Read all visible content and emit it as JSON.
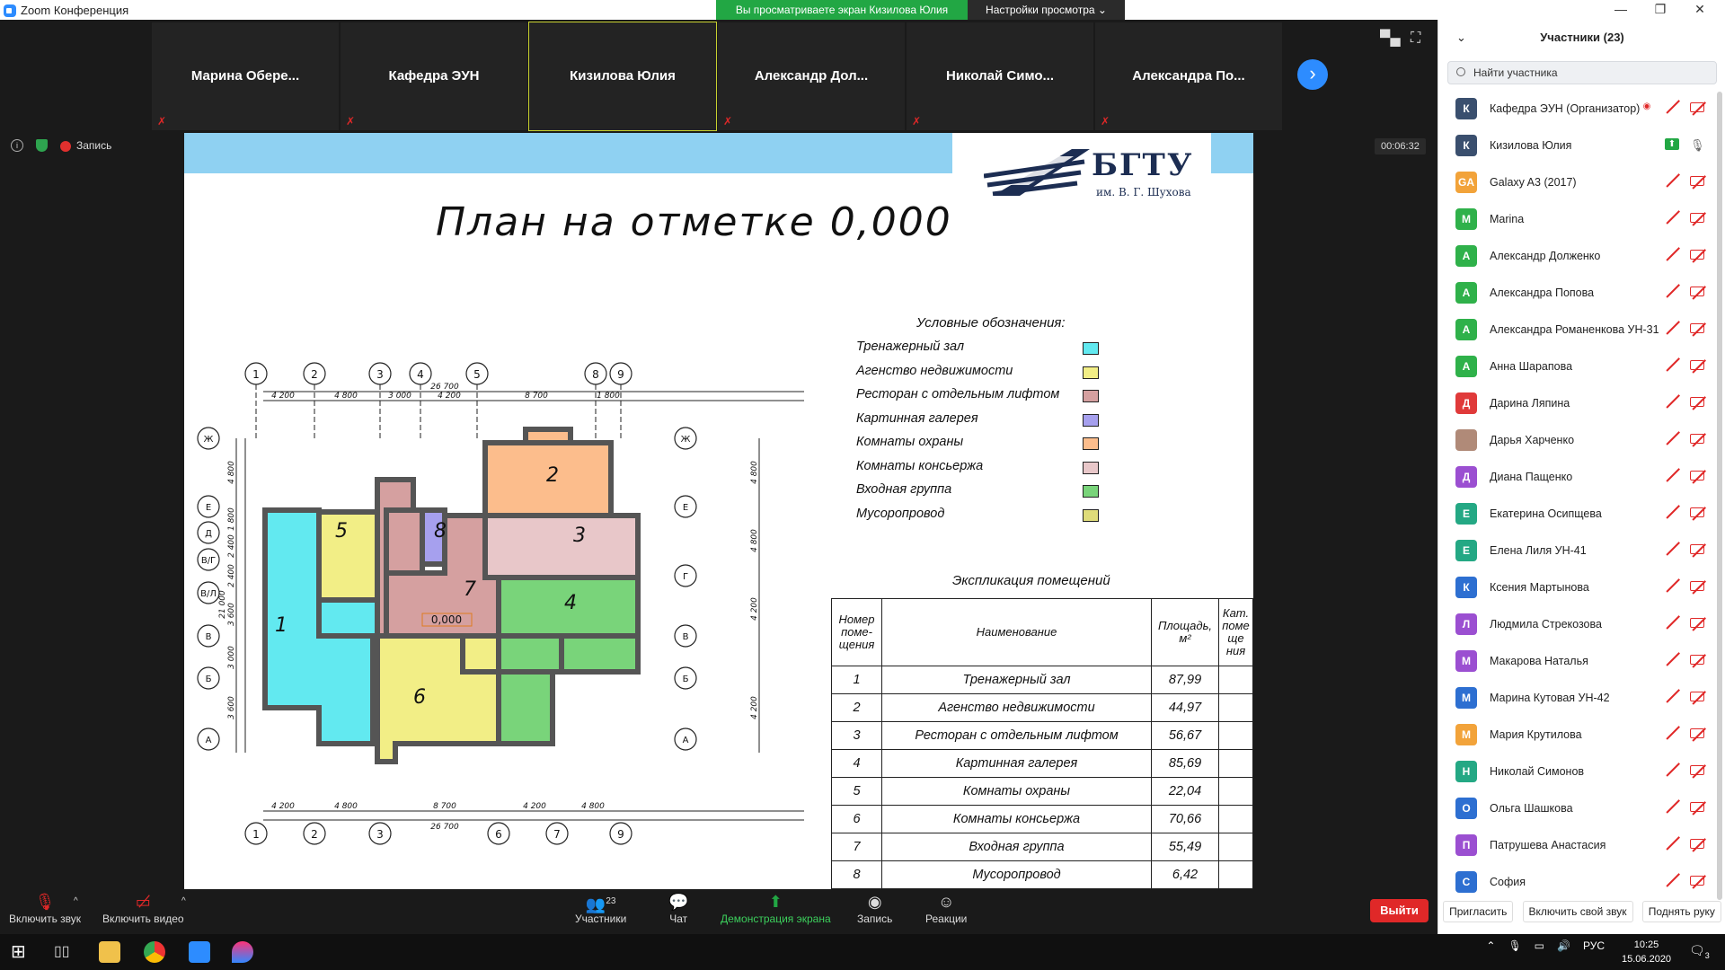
{
  "window": {
    "title": "Zoom Конференция",
    "minimize_label": "—",
    "maximize_label": "❐",
    "close_label": "✕"
  },
  "share_banner": {
    "viewing_label": "Вы просматриваете экран Кизилова Юлия",
    "settings_label": "Настройки просмотра ⌄"
  },
  "tiles": [
    {
      "name": "Марина  Обере...",
      "muted": true
    },
    {
      "name": "Кафедра ЭУН",
      "muted": true
    },
    {
      "name": "Кизилова Юлия",
      "muted": false,
      "active": true
    },
    {
      "name": "Александр  Дол...",
      "muted": true
    },
    {
      "name": "Николай  Симо...",
      "muted": true
    },
    {
      "name": "Александра  По...",
      "muted": true
    }
  ],
  "recording": {
    "label": "Запись"
  },
  "meeting_timer": "00:06:32",
  "slide": {
    "logo_name": "БГТУ",
    "logo_sub": "им. В. Г. Шухова",
    "title": "План на отметке 0,000",
    "legend_title": "Условные обозначения:",
    "legend": [
      {
        "label": "Тренажерный зал",
        "color": "#62e9f0"
      },
      {
        "label": "Агенство недвижимости",
        "color": "#f2ee86"
      },
      {
        "label": "Ресторан с отдельным лифтом",
        "color": "#d5a0a0"
      },
      {
        "label": "Картинная галерея",
        "color": "#a6a0ee"
      },
      {
        "label": "Комнаты охраны",
        "color": "#fcbd8c"
      },
      {
        "label": "Комнаты консьержа",
        "color": "#e8c7c9"
      },
      {
        "label": "Входная группа",
        "color": "#79d47a"
      },
      {
        "label": "Мусоропровод",
        "color": "#dfdc7a"
      }
    ],
    "explication_title": "Экспликация помещений",
    "table_headers": {
      "num": "Номер поме-щения",
      "name": "Наименование",
      "area": "Площадь, м²",
      "cat": "Кат. поме ще ния"
    },
    "rows": [
      {
        "num": "1",
        "name": "Тренажерный зал",
        "area": "87,99"
      },
      {
        "num": "2",
        "name": "Агенство недвижимости",
        "area": "44,97"
      },
      {
        "num": "3",
        "name": "Ресторан с отдельным лифтом",
        "area": "56,67"
      },
      {
        "num": "4",
        "name": "Картинная галерея",
        "area": "85,69"
      },
      {
        "num": "5",
        "name": "Комнаты охраны",
        "area": "22,04"
      },
      {
        "num": "6",
        "name": "Комнаты консьержа",
        "area": "70,66"
      },
      {
        "num": "7",
        "name": "Входная группа",
        "area": "55,49"
      },
      {
        "num": "8",
        "name": "Мусоропровод",
        "area": "6,42"
      }
    ],
    "plan": {
      "axes_top": [
        "1",
        "2",
        "3",
        "4",
        "5",
        "8",
        "9"
      ],
      "axes_bottom": [
        "1",
        "2",
        "3",
        "6",
        "7",
        "9"
      ],
      "axes_left": [
        "Ж",
        "Е",
        "Д",
        "В/Г",
        "В/Л",
        "В",
        "Б",
        "А"
      ],
      "axes_right": [
        "Ж",
        "Е",
        "Г",
        "В",
        "Б",
        "А"
      ],
      "dims_top": [
        "4 200",
        "4 800",
        "3 000",
        "4 200",
        "8 700",
        "1 800"
      ],
      "dims_top_total": "26 700",
      "dims_bottom": [
        "4 200",
        "4 800",
        "8 700",
        "4 200",
        "4 800"
      ],
      "dims_bottom_total": "26 700",
      "dims_left": [
        "4 800",
        "1 800",
        "2 400",
        "2 400",
        "3 600",
        "3 000",
        "3 600"
      ],
      "dims_left_total": "21 000",
      "dims_right": [
        "4 800",
        "4 800",
        "4 200",
        "4 200"
      ],
      "room_numbers": [
        "1",
        "2",
        "3",
        "4",
        "5",
        "6",
        "7",
        "8"
      ],
      "elevation": "0,000"
    }
  },
  "toolbar": {
    "mute_label": "Включить звук",
    "video_label": "Включить видео",
    "participants_label": "Участники",
    "participants_count": "23",
    "chat_label": "Чат",
    "share_label": "Демонстрация экрана",
    "record_label": "Запись",
    "reactions_label": "Реакции",
    "leave_label": "Выйти"
  },
  "panel": {
    "title": "Участники (23)",
    "search_placeholder": "Найти участника",
    "participants": [
      {
        "name": "Кафедра ЭУН (Организатор)",
        "initial": "К",
        "color": "#3a4f6e",
        "status": "host"
      },
      {
        "name": "Кизилова Юлия",
        "initial": "К",
        "color": "#3a4f6e",
        "status": "sharing"
      },
      {
        "name": "Galaxy A3 (2017)",
        "initial": "GA",
        "color": "#f2a33a",
        "status": "muted"
      },
      {
        "name": "Marina",
        "initial": "M",
        "color": "#2fb14a",
        "status": "muted"
      },
      {
        "name": "Александр Долженко",
        "initial": "А",
        "color": "#2fb14a",
        "status": "muted"
      },
      {
        "name": "Александра Попова",
        "initial": "А",
        "color": "#2fb14a",
        "status": "muted"
      },
      {
        "name": "Александра Романенкова УН-31",
        "initial": "А",
        "color": "#2fb14a",
        "status": "muted"
      },
      {
        "name": "Анна Шарапова",
        "initial": "А",
        "color": "#2fb14a",
        "status": "muted"
      },
      {
        "name": "Дарина Ляпина",
        "initial": "Д",
        "color": "#e03a3a",
        "status": "muted"
      },
      {
        "name": "Дарья Харченко",
        "initial": "",
        "color": "#b08a78",
        "status": "muted"
      },
      {
        "name": "Диана Пащенко",
        "initial": "Д",
        "color": "#9b4fd1",
        "status": "muted"
      },
      {
        "name": "Екатерина Осипщева",
        "initial": "Е",
        "color": "#24a884",
        "status": "muted"
      },
      {
        "name": "Елена Лиля УН-41",
        "initial": "Е",
        "color": "#24a884",
        "status": "muted"
      },
      {
        "name": "Ксения Мартынова",
        "initial": "К",
        "color": "#2d6fd1",
        "status": "muted"
      },
      {
        "name": "Людмила Стрекозова",
        "initial": "Л",
        "color": "#9b4fd1",
        "status": "muted"
      },
      {
        "name": "Макарова Наталья",
        "initial": "М",
        "color": "#9b4fd1",
        "status": "muted"
      },
      {
        "name": "Марина Кутовая УН-42",
        "initial": "М",
        "color": "#2d6fd1",
        "status": "muted"
      },
      {
        "name": "Мария Крутилова",
        "initial": "М",
        "color": "#f2a33a",
        "status": "muted"
      },
      {
        "name": "Николай Симонов",
        "initial": "Н",
        "color": "#24a884",
        "status": "muted"
      },
      {
        "name": "Ольга Шашкова",
        "initial": "О",
        "color": "#2d6fd1",
        "status": "muted"
      },
      {
        "name": "Патрушева Анастасия",
        "initial": "П",
        "color": "#9b4fd1",
        "status": "muted"
      },
      {
        "name": "София",
        "initial": "С",
        "color": "#2d6fd1",
        "status": "muted"
      }
    ],
    "invite_label": "Пригласить",
    "unmute_me_label": "Включить свой звук",
    "raise_hand_label": "Поднять руку"
  },
  "taskbar": {
    "language": "РУС",
    "time": "10:25",
    "date": "15.06.2020",
    "notifications": "3"
  },
  "colors": {
    "zoom_blue": "#2d8cff",
    "share_green": "#22a744",
    "leave_red": "#e02828"
  }
}
